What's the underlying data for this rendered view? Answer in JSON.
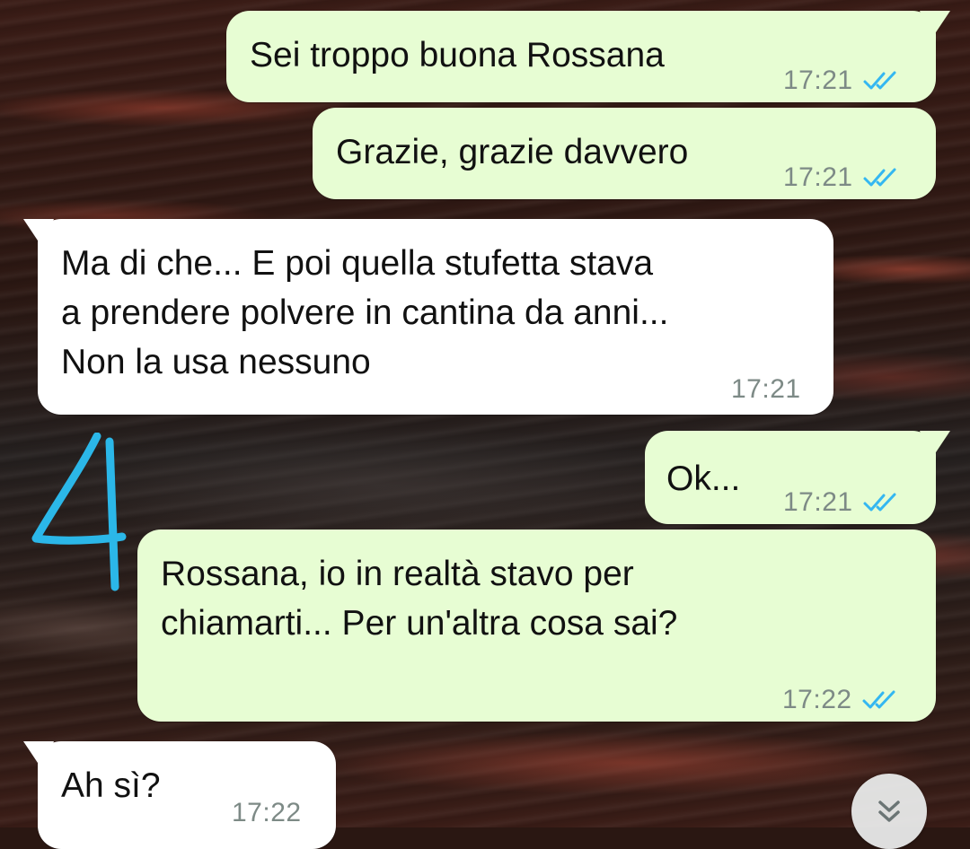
{
  "conversation": {
    "messages": [
      {
        "text": "Sei troppo buona Rossana",
        "time": "17:21",
        "direction": "outgoing",
        "status": "read"
      },
      {
        "text": "Grazie, grazie davvero",
        "time": "17:21",
        "direction": "outgoing",
        "status": "read"
      },
      {
        "text": "Ma di che... E poi quella stufetta stava\na prendere polvere in cantina da anni...\nNon la usa nessuno",
        "time": "17:21",
        "direction": "incoming"
      },
      {
        "text": "Ok...",
        "time": "17:21",
        "direction": "outgoing",
        "status": "read"
      },
      {
        "text": "Rossana, io in realtà stavo per\nchiamarti... Per un'altra cosa sai?",
        "time": "17:22",
        "direction": "outgoing",
        "status": "read"
      },
      {
        "text": "Ah sì?",
        "time": "17:22",
        "direction": "incoming"
      }
    ]
  },
  "colors": {
    "outgoing_bubble": "#e7fdd3",
    "incoming_bubble": "#ffffff",
    "read_ticks": "#34b7f1",
    "annotation": "#2bb7e8"
  },
  "icons": {
    "read_receipt": "double-check-icon",
    "scroll_down": "double-chevron-down-icon"
  }
}
